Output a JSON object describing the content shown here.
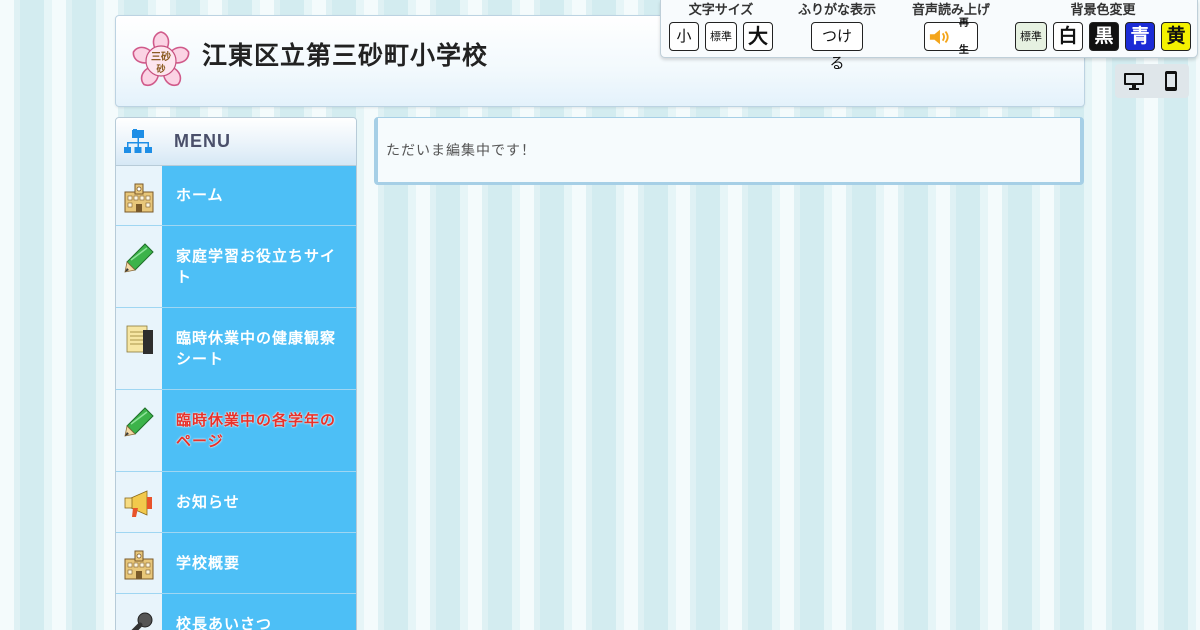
{
  "site": {
    "title": "江東区立第三砂町小学校",
    "logo_text": "三砂"
  },
  "accessibility": {
    "font_size": {
      "label": "文字サイズ",
      "buttons": [
        "小",
        "標準",
        "大"
      ]
    },
    "furigana": {
      "label": "ふりがな表示",
      "button": "つける"
    },
    "speech": {
      "label": "音声読み上げ",
      "button": "再生"
    },
    "background": {
      "label": "背景色変更",
      "buttons": [
        "標準",
        "白",
        "黒",
        "青",
        "黄"
      ]
    }
  },
  "device_switch": {
    "pc_icon": "desktop-icon",
    "sp_icon": "smartphone-icon"
  },
  "menu": {
    "title": "MENU",
    "items": [
      {
        "label": "ホーム",
        "icon": "school-building-icon"
      },
      {
        "label": "家庭学習お役立ちサイト",
        "icon": "pencil-icon"
      },
      {
        "label": "臨時休業中の健康観察シート",
        "icon": "notebook-icon"
      },
      {
        "label": "臨時休業中の各学年のページ",
        "icon": "pencil-icon",
        "current": true
      },
      {
        "label": "お知らせ",
        "icon": "megaphone-icon"
      },
      {
        "label": "学校概要",
        "icon": "school-building-icon"
      },
      {
        "label": "校長あいさつ",
        "icon": "microphone-icon"
      }
    ]
  },
  "main": {
    "notice": "ただいま編集中です！"
  },
  "colors": {
    "menu_item_bg": "#4dbff6",
    "current_item_text": "#e8322b",
    "bg_blue": "#1b2bd6",
    "bg_yellow": "#f4f200"
  }
}
